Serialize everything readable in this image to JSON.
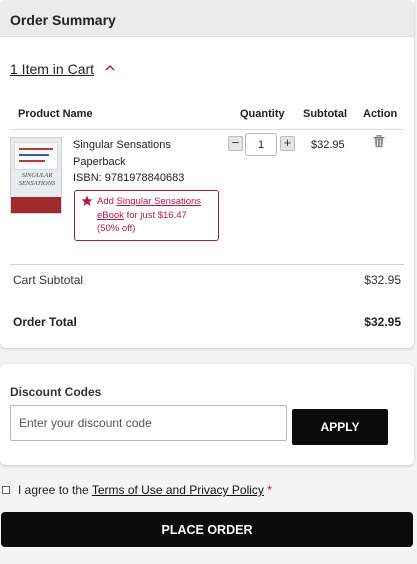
{
  "summary": {
    "title": "Order Summary",
    "cart_toggle": "1 Item in Cart",
    "columns": {
      "product": "Product Name",
      "quantity": "Quantity",
      "subtotal": "Subtotal",
      "action": "Action"
    },
    "item": {
      "name": "Singular Sensations",
      "format": "Paperback",
      "isbn": "ISBN: 9781978840683",
      "cover_title": "SINGULAR SENSATIONS",
      "quantity": "1",
      "subtotal": "$32.95",
      "promo": {
        "prefix": "Add",
        "link": "Singular Sensations eBook",
        "suffix": "for just $16.47",
        "discount": "(50% off)"
      }
    },
    "cart_subtotal_label": "Cart Subtotal",
    "cart_subtotal_value": "$32.95",
    "order_total_label": "Order Total",
    "order_total_value": "$32.95"
  },
  "discount": {
    "title": "Discount Codes",
    "placeholder": "Enter your discount code",
    "apply_label": "APPLY"
  },
  "terms": {
    "prefix": "I agree to the",
    "link": "Terms of Use and Privacy Policy",
    "required_marker": "*"
  },
  "place_order_label": "PLACE ORDER",
  "colors": {
    "accent": "#b5154f",
    "button": "#0b0b0b"
  }
}
